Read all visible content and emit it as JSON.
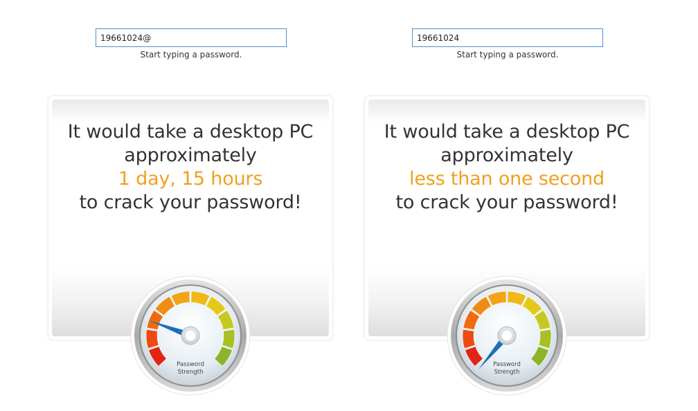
{
  "hint_text": "Start typing a password.",
  "panels": [
    {
      "password_value": "19661024@",
      "message": {
        "line1": "It would take a desktop PC",
        "line2": "approximately",
        "time": "1 day, 15 hours",
        "line4": "to crack your password!"
      },
      "gauge": {
        "label_line1": "Password",
        "label_line2": "Strength",
        "needle_angle_deg": 290
      }
    },
    {
      "password_value": "19661024",
      "message": {
        "line1": "It would take a desktop PC",
        "line2": "approximately",
        "time": "less than one second",
        "line4": "to crack your password!"
      },
      "gauge": {
        "label_line1": "Password",
        "label_line2": "Strength",
        "needle_angle_deg": 220
      }
    }
  ],
  "colors": {
    "accent_orange": "#f0a020",
    "input_border": "#4a90c8",
    "needle_blue": "#1c6fb8"
  }
}
